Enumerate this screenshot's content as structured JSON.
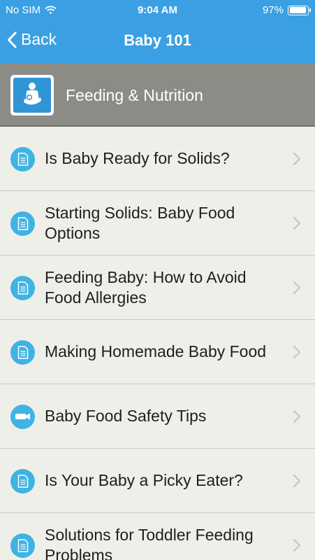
{
  "status_bar": {
    "carrier": "No SIM",
    "time": "9:04 AM",
    "battery": "97%"
  },
  "nav": {
    "back_label": "Back",
    "title": "Baby 101"
  },
  "section": {
    "title": "Feeding & Nutrition",
    "icon": "mother-baby-icon"
  },
  "items": [
    {
      "label": "Is Baby Ready for Solids?",
      "icon": "document-icon"
    },
    {
      "label": "Starting Solids: Baby Food Options",
      "icon": "document-icon"
    },
    {
      "label": "Feeding Baby: How to Avoid Food Allergies",
      "icon": "document-icon"
    },
    {
      "label": "Making Homemade Baby Food",
      "icon": "document-icon"
    },
    {
      "label": "Baby Food Safety Tips",
      "icon": "video-icon"
    },
    {
      "label": "Is Your Baby a Picky Eater?",
      "icon": "document-icon"
    },
    {
      "label": "Solutions for Toddler Feeding Problems",
      "icon": "document-icon"
    }
  ],
  "colors": {
    "header": "#3aa0e3",
    "section": "#8c8c86",
    "row_icon": "#3fb3e3",
    "background": "#efefea"
  }
}
